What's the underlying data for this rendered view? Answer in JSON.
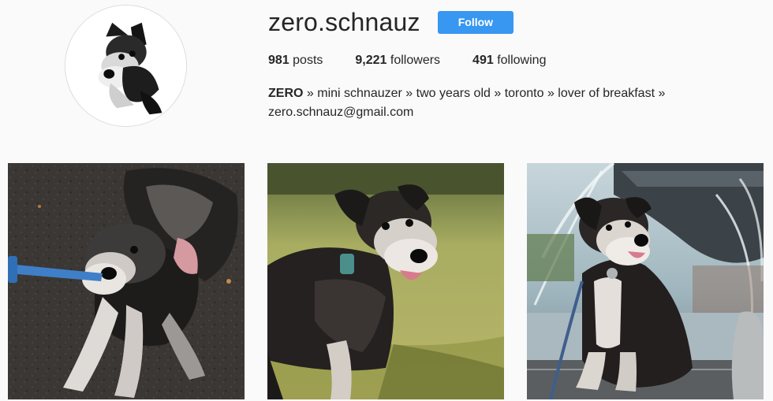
{
  "profile": {
    "username": "zero.schnauz",
    "follow_label": "Follow",
    "stats": {
      "posts_count": "981",
      "posts_label": "posts",
      "followers_count": "9,221",
      "followers_label": "followers",
      "following_count": "491",
      "following_label": "following"
    },
    "bio": {
      "name": "ZERO",
      "text": " » mini schnauzer » two years old » toronto » lover of breakfast »",
      "email": "zero.schnauz@gmail.com"
    }
  },
  "colors": {
    "accent": "#3897f0",
    "background": "#fafafa",
    "text": "#262626"
  },
  "posts": [
    {
      "icon": "dog-on-asphalt-photo"
    },
    {
      "icon": "dog-on-grass-photo"
    },
    {
      "icon": "dog-by-fountain-photo"
    }
  ]
}
